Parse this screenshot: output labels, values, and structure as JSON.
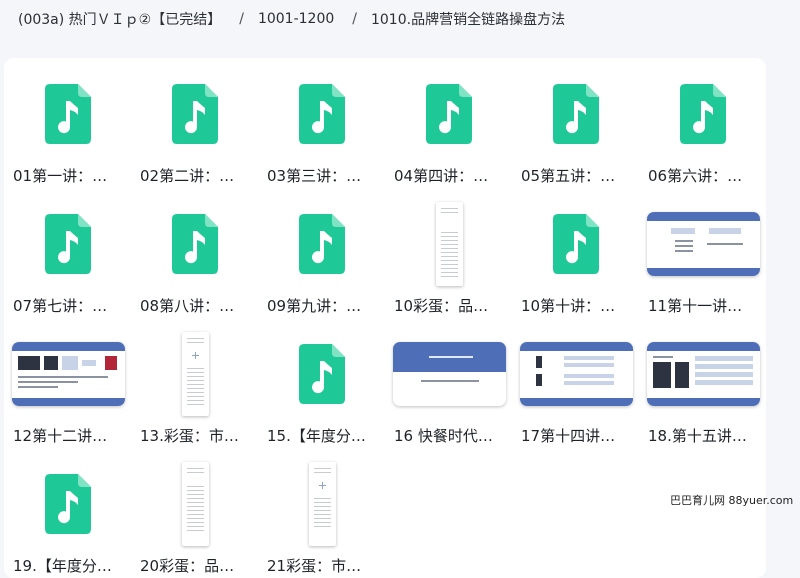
{
  "breadcrumb": {
    "parts": [
      "(003a) 热门ＶＩｐ②【已完结】",
      "1001-1200",
      "1010.品牌营销全链路操盘方法"
    ],
    "separator": "/"
  },
  "colors": {
    "audio_icon": "#1ec997",
    "slide_bar": "#4e6fb8"
  },
  "files": [
    {
      "label": "01第一讲：…",
      "thumb": "audio-icon"
    },
    {
      "label": "02第二讲：…",
      "thumb": "audio-icon"
    },
    {
      "label": "03第三讲：…",
      "thumb": "audio-icon"
    },
    {
      "label": "04第四讲：…",
      "thumb": "audio-icon"
    },
    {
      "label": "05第五讲：…",
      "thumb": "audio-icon"
    },
    {
      "label": "06第六讲：…",
      "thumb": "audio-icon"
    },
    {
      "label": "07第七讲：…",
      "thumb": "audio-icon"
    },
    {
      "label": "08第八讲：…",
      "thumb": "audio-icon"
    },
    {
      "label": "09第九讲：…",
      "thumb": "audio-icon"
    },
    {
      "label": "10彩蛋：品…",
      "thumb": "document-thumbnail"
    },
    {
      "label": "10第十讲：…",
      "thumb": "audio-icon"
    },
    {
      "label": "11第十一讲…",
      "thumb": "slide-thumbnail"
    },
    {
      "label": "12第十二讲…",
      "thumb": "slide-thumbnail"
    },
    {
      "label": "13.彩蛋：市…",
      "thumb": "document-thumbnail"
    },
    {
      "label": "15.【年度分…",
      "thumb": "audio-icon"
    },
    {
      "label": "16 快餐时代…",
      "thumb": "slide-thumbnail"
    },
    {
      "label": "17第十四讲…",
      "thumb": "slide-thumbnail"
    },
    {
      "label": "18.第十五讲…",
      "thumb": "slide-thumbnail"
    },
    {
      "label": "19.【年度分…",
      "thumb": "audio-icon"
    },
    {
      "label": "20彩蛋：品…",
      "thumb": "document-thumbnail"
    },
    {
      "label": "21彩蛋：市…",
      "thumb": "document-thumbnail"
    }
  ],
  "watermark": "巴巴育儿网 88yuer.com"
}
